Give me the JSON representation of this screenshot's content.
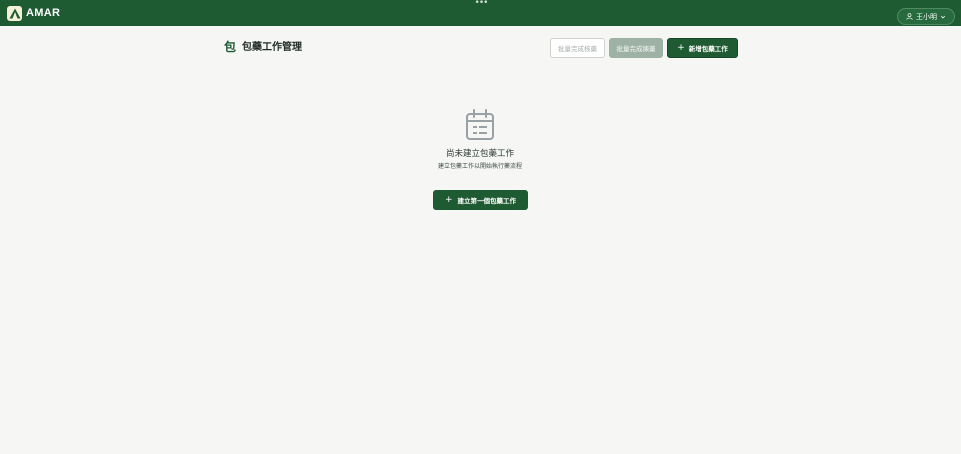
{
  "header": {
    "brand": "AMAR",
    "more_icon": "more-dots-icon",
    "user": {
      "name": "王小明",
      "icon": "user-icon",
      "caret": "chevron-down-icon"
    }
  },
  "page": {
    "title_icon": "包",
    "title": "包藥工作管理"
  },
  "toolbar": {
    "batch_verify_label": "批量完成核藥",
    "batch_collect_label": "批量完成揀藥",
    "new_task_label": "新增包藥工作",
    "plus_symbol": "+"
  },
  "empty_state": {
    "icon": "calendar-icon",
    "title": "尚未建立包藥工作",
    "subtitle": "建立包藥工作以開始執行藥流程",
    "cta_label": "建立第一個包藥工作",
    "plus_symbol": "+"
  },
  "colors": {
    "primary": "#1e5a32",
    "background": "#f6f6f5"
  }
}
